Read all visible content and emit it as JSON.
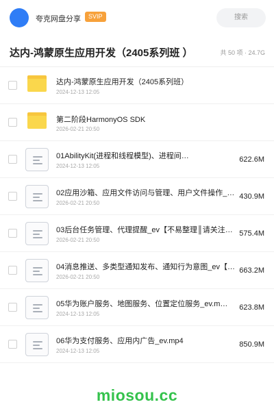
{
  "header": {
    "brand": "夸克网盘分享",
    "badge": "SVIP",
    "search_label": "搜索"
  },
  "folder": {
    "title": "达内-鸿蒙原生应用开发（2405系列班 ）",
    "meta": "共 50 项 · 24.7G"
  },
  "items": [
    {
      "type": "folder",
      "name": "达内-鸿蒙原生应用开发（2405系列班）",
      "date": "2024-12-13 12:05",
      "size": ""
    },
    {
      "type": "folder",
      "name": "第二阶段HarmonyOS SDK",
      "date": "2026-02-21 20:50",
      "size": ""
    },
    {
      "type": "file",
      "name": "01AbilityKit(进程和线程模型)、进程间…",
      "date": "2024-12-13 12:05",
      "size": "622.6M"
    },
    {
      "type": "file",
      "name": "02应用沙箱、应用文件访问与管理、用户文件操作_e…",
      "date": "2026-02-21 20:50",
      "size": "430.9M"
    },
    {
      "type": "file",
      "name": "03后台任务管理、代理提醒_ev【不易整理║请关注…",
      "date": "2026-02-21 20:50",
      "size": "575.4M"
    },
    {
      "type": "file",
      "name": "04消息推送、多类型通知发布、通知行为意图_ev【…",
      "date": "2026-02-21 20:50",
      "size": "663.2M"
    },
    {
      "type": "file",
      "name": "05华为账户服务、地图服务、位置定位服务_ev.m…",
      "date": "2024-12-13 12:05",
      "size": "623.8M"
    },
    {
      "type": "file",
      "name": "06华为支付服务、应用内广告_ev.mp4",
      "date": "2024-12-13 12:05",
      "size": "850.9M"
    }
  ],
  "watermark": "miosou.cc",
  "colors": {
    "avatar": "#2f7df6",
    "svip": "#f7a13b",
    "folder": "#fad74c",
    "watermark": "#34c24c"
  }
}
